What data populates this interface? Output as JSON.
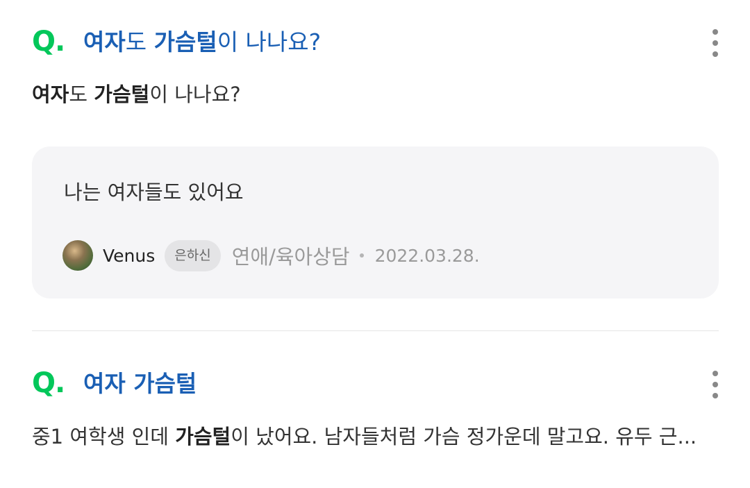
{
  "results": [
    {
      "q_mark": "Q.",
      "title": {
        "bold_1": "여자",
        "plain_1": "도 ",
        "bold_2": "가슴털",
        "plain_2": "이 나나요?"
      },
      "question": {
        "bold_1": "여자",
        "plain_1": "도 ",
        "bold_2": "가슴털",
        "plain_2": "이 나나요?"
      },
      "answer": {
        "text": "나는 여자들도 있어요",
        "author": "Venus",
        "badge": "은하신",
        "category": "연애/육아상담",
        "date": "2022.03.28."
      }
    },
    {
      "q_mark": "Q.",
      "title": {
        "bold": "여자 가슴털"
      },
      "snippet": {
        "plain_1": "중1 여학생 인데 ",
        "bold": "가슴털",
        "plain_2": "이 났어요. 남자들처럼 가슴 정가운데 말고요. 유두 근..."
      }
    }
  ],
  "icons": {
    "more": "more-vertical-icon",
    "avatar": "user-avatar"
  },
  "colors": {
    "q_mark": "#03c75a",
    "title": "#1a5fb4",
    "answer_bg": "#f5f5f7"
  }
}
